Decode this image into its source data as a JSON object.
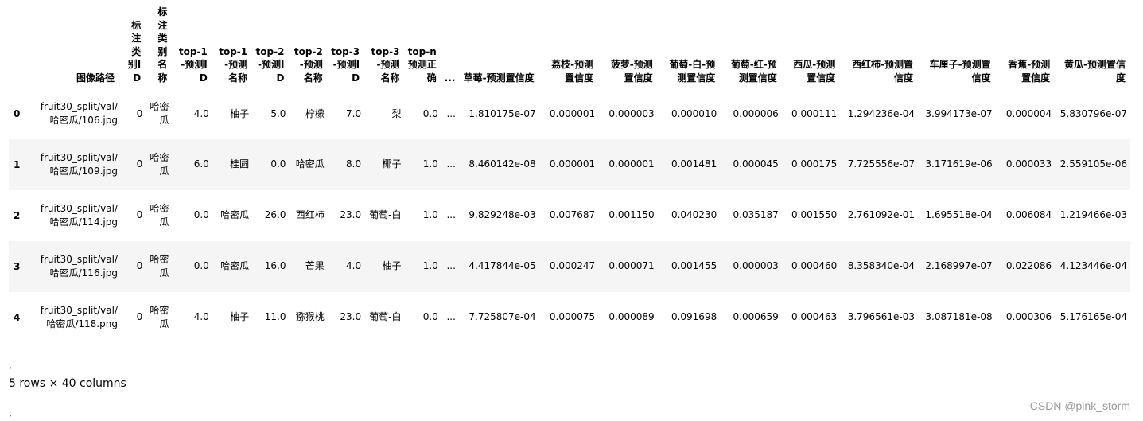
{
  "dataframe": {
    "columns": [
      "图像路径",
      "标注类别ID",
      "标注类别名称",
      "top-1-预测ID",
      "top-1-预测名称",
      "top-2-预测ID",
      "top-2-预测名称",
      "top-3-预测ID",
      "top-3-预测名称",
      "top-n预测正确",
      "...",
      "草莓-预测置信度",
      "荔枝-预测置信度",
      "菠萝-预测置信度",
      "葡萄-白-预测置信度",
      "葡萄-红-预测置信度",
      "西瓜-预测置信度",
      "西红柿-预测置信度",
      "车厘子-预测置信度",
      "香蕉-预测置信度",
      "黄瓜-预测置信度"
    ],
    "rows": [
      {
        "index": "0",
        "cells": [
          "fruit30_split/val/哈密瓜/106.jpg",
          "0",
          "哈密瓜",
          "4.0",
          "柚子",
          "5.0",
          "柠檬",
          "7.0",
          "梨",
          "0.0",
          "...",
          "1.810175e-07",
          "0.000001",
          "0.000003",
          "0.000010",
          "0.000006",
          "0.000111",
          "1.294236e-04",
          "3.994173e-07",
          "0.000004",
          "5.830796e-07"
        ]
      },
      {
        "index": "1",
        "cells": [
          "fruit30_split/val/哈密瓜/109.jpg",
          "0",
          "哈密瓜",
          "6.0",
          "桂圆",
          "0.0",
          "哈密瓜",
          "8.0",
          "椰子",
          "1.0",
          "...",
          "8.460142e-08",
          "0.000001",
          "0.000001",
          "0.001481",
          "0.000045",
          "0.000175",
          "7.725556e-07",
          "3.171619e-06",
          "0.000033",
          "2.559105e-06"
        ]
      },
      {
        "index": "2",
        "cells": [
          "fruit30_split/val/哈密瓜/114.jpg",
          "0",
          "哈密瓜",
          "0.0",
          "哈密瓜",
          "26.0",
          "西红柿",
          "23.0",
          "葡萄-白",
          "1.0",
          "...",
          "9.829248e-03",
          "0.007687",
          "0.001150",
          "0.040230",
          "0.035187",
          "0.001550",
          "2.761092e-01",
          "1.695518e-04",
          "0.006084",
          "1.219466e-03"
        ]
      },
      {
        "index": "3",
        "cells": [
          "fruit30_split/val/哈密瓜/116.jpg",
          "0",
          "哈密瓜",
          "0.0",
          "哈密瓜",
          "16.0",
          "芒果",
          "4.0",
          "柚子",
          "1.0",
          "...",
          "4.417844e-05",
          "0.000247",
          "0.000071",
          "0.001455",
          "0.000003",
          "0.000460",
          "8.358340e-04",
          "2.168997e-07",
          "0.022086",
          "4.123446e-04"
        ]
      },
      {
        "index": "4",
        "cells": [
          "fruit30_split/val/哈密瓜/118.png",
          "0",
          "哈密瓜",
          "4.0",
          "柚子",
          "11.0",
          "猕猴桃",
          "23.0",
          "葡萄-白",
          "0.0",
          "...",
          "7.725807e-04",
          "0.000075",
          "0.000089",
          "0.091698",
          "0.000659",
          "0.000463",
          "3.796561e-03",
          "3.087181e-08",
          "0.000306",
          "5.176165e-04"
        ]
      }
    ]
  },
  "footer": {
    "mark1": ",",
    "shape": "5 rows × 40 columns",
    "mark2": ","
  },
  "watermark": "CSDN @pink_storm"
}
